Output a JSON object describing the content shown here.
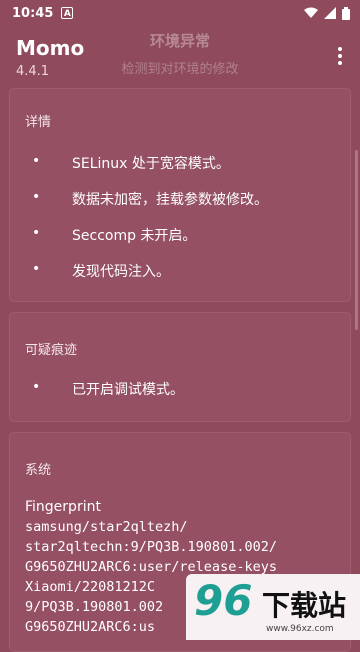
{
  "status_bar": {
    "time": "10:45",
    "notif_letter": "A",
    "icons": [
      "wifi-icon",
      "signal-icon",
      "battery-icon"
    ]
  },
  "app_bar": {
    "title": "Momo",
    "version": "4.4.1",
    "overlay_title": "环境异常",
    "overlay_subtitle": "检测到对环境的修改",
    "menu_icon": "more-vert-icon"
  },
  "details": {
    "title": "详情",
    "items": [
      "SELinux 处于宽容模式。",
      "数据未加密，挂载参数被修改。",
      "Seccomp 未开启。",
      "发现代码注入。"
    ]
  },
  "suspicious": {
    "title": "可疑痕迹",
    "items": [
      "已开启调试模式。"
    ]
  },
  "system": {
    "title": "系统",
    "fingerprint_label": "Fingerprint",
    "fingerprint_lines": [
      "samsung/star2qltezh/",
      "star2qltechn:9/PQ3B.190801.002/",
      "G9650ZHU2ARC6:user/release-keys",
      "Xiaomi/22081212C",
      "9/PQ3B.190801.002",
      "G9650ZHU2ARC6:us"
    ]
  },
  "bullet_char": "•",
  "watermark": {
    "logo": "96",
    "text": "下载站",
    "url": "www.96xz.com"
  },
  "colors": {
    "background": "#8f4a5c",
    "card": "#955163",
    "watermark_accent": "#1f9f93"
  }
}
